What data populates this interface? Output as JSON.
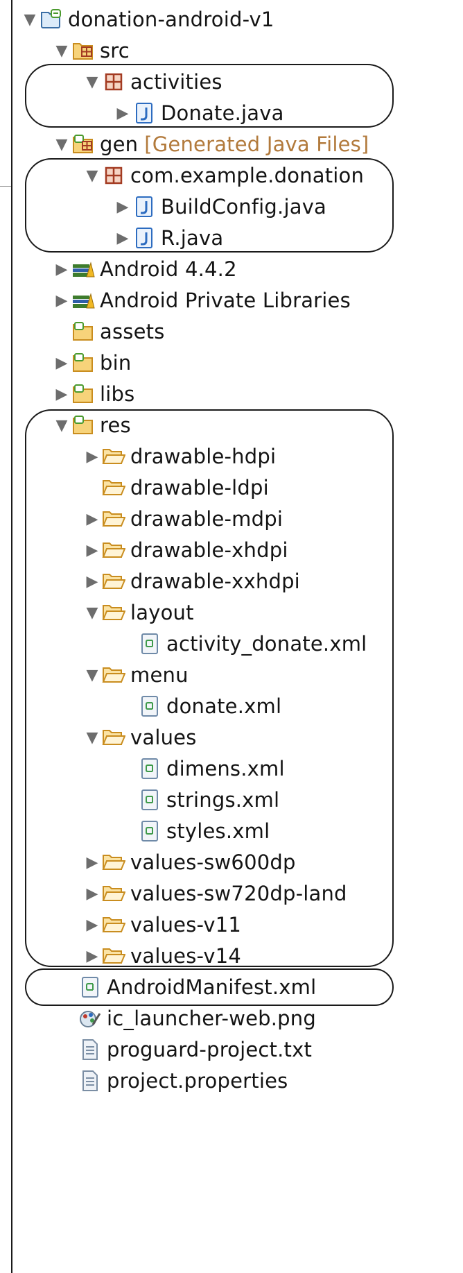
{
  "tree": {
    "project": {
      "label": "donation-android-v1"
    },
    "src": {
      "label": "src"
    },
    "activities": {
      "label": "activities"
    },
    "donate_java": {
      "label": "Donate.java"
    },
    "gen": {
      "label": "gen",
      "decoration": "[Generated Java Files]"
    },
    "pkg": {
      "label": "com.example.donation"
    },
    "buildconfig": {
      "label": "BuildConfig.java"
    },
    "r_java": {
      "label": "R.java"
    },
    "android_lib": {
      "label": "Android 4.4.2"
    },
    "private_libs": {
      "label": "Android Private Libraries"
    },
    "assets": {
      "label": "assets"
    },
    "bin": {
      "label": "bin"
    },
    "libs": {
      "label": "libs"
    },
    "res": {
      "label": "res"
    },
    "drawable_hdpi": {
      "label": "drawable-hdpi"
    },
    "drawable_ldpi": {
      "label": "drawable-ldpi"
    },
    "drawable_mdpi": {
      "label": "drawable-mdpi"
    },
    "drawable_xhdpi": {
      "label": "drawable-xhdpi"
    },
    "drawable_xxhdpi": {
      "label": "drawable-xxhdpi"
    },
    "layout": {
      "label": "layout"
    },
    "activity_donate": {
      "label": "activity_donate.xml"
    },
    "menu": {
      "label": "menu"
    },
    "donate_xml": {
      "label": "donate.xml"
    },
    "values": {
      "label": "values"
    },
    "dimens": {
      "label": "dimens.xml"
    },
    "strings": {
      "label": "strings.xml"
    },
    "styles": {
      "label": "styles.xml"
    },
    "values_sw600dp": {
      "label": "values-sw600dp"
    },
    "values_sw720dp_land": {
      "label": "values-sw720dp-land"
    },
    "values_v11": {
      "label": "values-v11"
    },
    "values_v14": {
      "label": "values-v14"
    },
    "manifest": {
      "label": "AndroidManifest.xml"
    },
    "ic_launcher": {
      "label": "ic_launcher-web.png"
    },
    "proguard": {
      "label": "proguard-project.txt"
    },
    "project_properties": {
      "label": "project.properties"
    }
  },
  "icons": {
    "project": "android-project-icon",
    "src": "source-folder-icon",
    "package": "package-icon",
    "java": "java-file-icon",
    "library": "library-icon",
    "folder": "folder-icon",
    "xml": "xml-file-icon",
    "image": "image-file-icon",
    "text": "text-file-icon"
  },
  "colors": {
    "folder": "#f2b64c",
    "package": "#a33b22",
    "java": "#2d6cc0",
    "decoration": "#b27a3c",
    "outline": "#1a1a1a",
    "pointer": "#b7b7b7"
  }
}
